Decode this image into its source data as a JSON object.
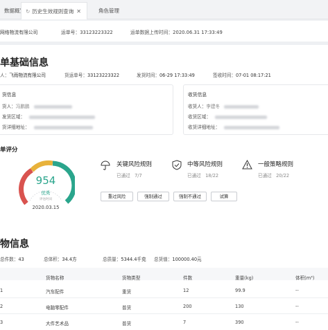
{
  "tabs": [
    {
      "label": "数据概览",
      "icon": "",
      "closable": false
    },
    {
      "label": "历史生效规则查询",
      "icon": "refresh-icon",
      "closable": true
    },
    {
      "label": "角色管理",
      "icon": "",
      "closable": false
    }
  ],
  "meta": {
    "company": "网络物流有限公司",
    "waybill_label": "运单号：",
    "waybill_no": "33123223322",
    "upload_label": "运单数据上传时间：",
    "upload_time": "2020.06.31 17:33:49"
  },
  "basic": {
    "title": "单基础信息",
    "carrier_label": "人：",
    "carrier": "飞雨物流有限公司",
    "goods_no_label": "货运单号：",
    "goods_no": "33123223322",
    "ship_time_label": "发货时间：",
    "ship_time": "06-29 17:33:49",
    "sign_time_label": "签收时间：",
    "sign_time": "07-01 08:17:21"
  },
  "sender": {
    "title": "货信息",
    "person_label": "货人：",
    "person": "冯鹏鹏",
    "region_label": "发货区域：",
    "addr_label": "货详细地址："
  },
  "receiver": {
    "title": "收货信息",
    "person_label": "收货人：",
    "person": "李建冬",
    "region_label": "收货区域：",
    "addr_label": "收货详细地址："
  },
  "rating": {
    "title": "单评分",
    "score": "954",
    "score_label": "优秀",
    "tiny": "评估时间",
    "date": "2020.03.15",
    "colors": {
      "good": "#2aa58c",
      "mid": "#e8b23b",
      "bad": "#d9534f"
    }
  },
  "rules": [
    {
      "name": "关键风险规则",
      "status_label": "已通过",
      "status": "7/7",
      "icon": "umbrella-icon"
    },
    {
      "name": "中等风险规则",
      "status_label": "已通过",
      "status": "18/22",
      "icon": "shield-check-icon"
    },
    {
      "name": "一般策略规则",
      "status_label": "已通过",
      "status": "20/22",
      "icon": "warning-icon"
    }
  ],
  "actions": [
    "重过风险",
    "强制通过",
    "强制不通过",
    "试算"
  ],
  "goods": {
    "title": "物信息",
    "stats": [
      {
        "label": "总件数：",
        "value": "43"
      },
      {
        "label": "总体积：",
        "value": "34.4方"
      },
      {
        "label": "总质量：",
        "value": "5344.4千克"
      },
      {
        "label": "总货值：",
        "value": "100000.40元"
      }
    ],
    "columns": [
      "",
      "货物名称",
      "货物类型",
      "件数",
      "重量(kg)",
      "体积(m³)"
    ],
    "rows": [
      [
        "1",
        "汽车配件",
        "重货",
        "12",
        "99.9",
        "--"
      ],
      [
        "2",
        "电脑零配件",
        "普货",
        "200",
        "130",
        "--"
      ],
      [
        "3",
        "大件艺术品",
        "普货",
        "7",
        "390",
        "--"
      ]
    ]
  }
}
